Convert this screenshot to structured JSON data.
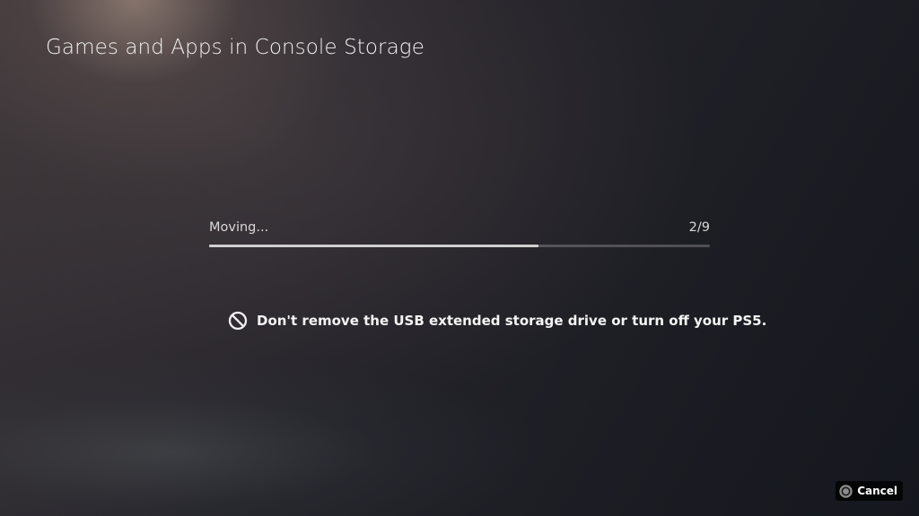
{
  "header": {
    "title": "Games and Apps in Console Storage"
  },
  "progress": {
    "status": "Moving...",
    "count": "2/9",
    "fraction": 0.657
  },
  "warning": {
    "icon": "prohibited-icon",
    "text": "Don't remove the USB extended storage drive or turn off your PS5."
  },
  "footer": {
    "cancel_icon": "circle-button-icon",
    "cancel_label": "Cancel"
  },
  "colors": {
    "progress_fill": "#cfcfcf",
    "progress_track": "#ffffff38",
    "text": "#f4f4f4"
  }
}
